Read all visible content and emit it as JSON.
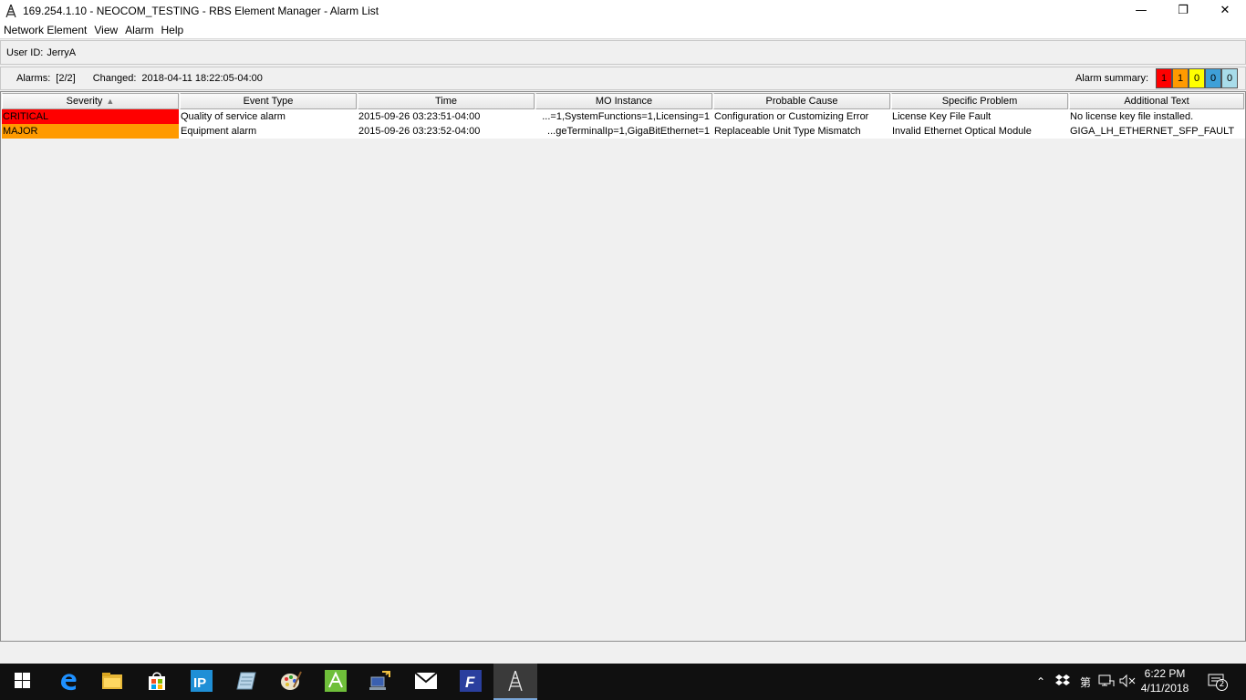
{
  "window": {
    "title": "169.254.1.10 - NEOCOM_TESTING - RBS Element Manager - Alarm List",
    "minimize_glyph": "—",
    "restore_glyph": "❐",
    "close_glyph": "✕"
  },
  "menu": [
    "Network Element",
    "View",
    "Alarm",
    "Help"
  ],
  "user": {
    "label": "User ID:",
    "value": "JerryA"
  },
  "status": {
    "alarms_label": "Alarms:",
    "alarms_value": "[2/2]",
    "changed_label": "Changed:",
    "changed_value": "2018-04-11 18:22:05-04:00",
    "summary_label": "Alarm summary:",
    "summary": [
      {
        "value": "1",
        "color": "#ff0000"
      },
      {
        "value": "1",
        "color": "#ff9a00"
      },
      {
        "value": "0",
        "color": "#ffff00"
      },
      {
        "value": "0",
        "color": "#3ea0d8"
      },
      {
        "value": "0",
        "color": "#a8dcea"
      }
    ]
  },
  "table": {
    "columns": [
      "Severity",
      "Event Type",
      "Time",
      "MO Instance",
      "Probable Cause",
      "Specific Problem",
      "Additional Text"
    ],
    "sort_column": "Severity",
    "rows": [
      {
        "severity": "CRITICAL",
        "severity_color": "#ff0000",
        "event_type": "Quality of service alarm",
        "time": "2015-09-26 03:23:51-04:00",
        "mo_instance": "...=1,SystemFunctions=1,Licensing=1",
        "probable_cause": "Configuration or Customizing Error",
        "specific_problem": "License Key File Fault",
        "additional_text": "No license key file installed."
      },
      {
        "severity": "MAJOR",
        "severity_color": "#ff9a00",
        "event_type": "Equipment alarm",
        "time": "2015-09-26 03:23:52-04:00",
        "mo_instance": "...geTerminalIp=1,GigaBitEthernet=1",
        "probable_cause": "Replaceable Unit Type Mismatch",
        "specific_problem": "Invalid Ethernet Optical Module",
        "additional_text": "GIGA_LH_ETHERNET_SFP_FAULT"
      }
    ]
  },
  "taskbar": {
    "clock_time": "6:22 PM",
    "clock_date": "4/11/2018",
    "notification_count": "2",
    "input_indicator": "第"
  }
}
